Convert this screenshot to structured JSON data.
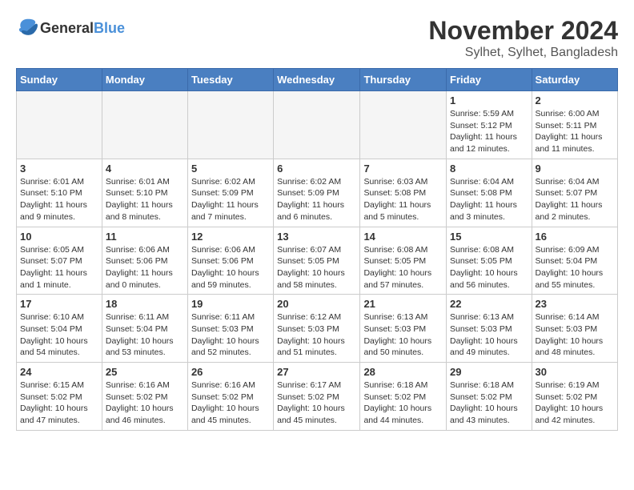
{
  "header": {
    "logo_general": "General",
    "logo_blue": "Blue",
    "month_title": "November 2024",
    "location": "Sylhet, Sylhet, Bangladesh"
  },
  "weekdays": [
    "Sunday",
    "Monday",
    "Tuesday",
    "Wednesday",
    "Thursday",
    "Friday",
    "Saturday"
  ],
  "weeks": [
    [
      {
        "day": "",
        "info": "",
        "empty": true
      },
      {
        "day": "",
        "info": "",
        "empty": true
      },
      {
        "day": "",
        "info": "",
        "empty": true
      },
      {
        "day": "",
        "info": "",
        "empty": true
      },
      {
        "day": "",
        "info": "",
        "empty": true
      },
      {
        "day": "1",
        "info": "Sunrise: 5:59 AM\nSunset: 5:12 PM\nDaylight: 11 hours and 12 minutes."
      },
      {
        "day": "2",
        "info": "Sunrise: 6:00 AM\nSunset: 5:11 PM\nDaylight: 11 hours and 11 minutes."
      }
    ],
    [
      {
        "day": "3",
        "info": "Sunrise: 6:01 AM\nSunset: 5:10 PM\nDaylight: 11 hours and 9 minutes."
      },
      {
        "day": "4",
        "info": "Sunrise: 6:01 AM\nSunset: 5:10 PM\nDaylight: 11 hours and 8 minutes."
      },
      {
        "day": "5",
        "info": "Sunrise: 6:02 AM\nSunset: 5:09 PM\nDaylight: 11 hours and 7 minutes."
      },
      {
        "day": "6",
        "info": "Sunrise: 6:02 AM\nSunset: 5:09 PM\nDaylight: 11 hours and 6 minutes."
      },
      {
        "day": "7",
        "info": "Sunrise: 6:03 AM\nSunset: 5:08 PM\nDaylight: 11 hours and 5 minutes."
      },
      {
        "day": "8",
        "info": "Sunrise: 6:04 AM\nSunset: 5:08 PM\nDaylight: 11 hours and 3 minutes."
      },
      {
        "day": "9",
        "info": "Sunrise: 6:04 AM\nSunset: 5:07 PM\nDaylight: 11 hours and 2 minutes."
      }
    ],
    [
      {
        "day": "10",
        "info": "Sunrise: 6:05 AM\nSunset: 5:07 PM\nDaylight: 11 hours and 1 minute."
      },
      {
        "day": "11",
        "info": "Sunrise: 6:06 AM\nSunset: 5:06 PM\nDaylight: 11 hours and 0 minutes."
      },
      {
        "day": "12",
        "info": "Sunrise: 6:06 AM\nSunset: 5:06 PM\nDaylight: 10 hours and 59 minutes."
      },
      {
        "day": "13",
        "info": "Sunrise: 6:07 AM\nSunset: 5:05 PM\nDaylight: 10 hours and 58 minutes."
      },
      {
        "day": "14",
        "info": "Sunrise: 6:08 AM\nSunset: 5:05 PM\nDaylight: 10 hours and 57 minutes."
      },
      {
        "day": "15",
        "info": "Sunrise: 6:08 AM\nSunset: 5:05 PM\nDaylight: 10 hours and 56 minutes."
      },
      {
        "day": "16",
        "info": "Sunrise: 6:09 AM\nSunset: 5:04 PM\nDaylight: 10 hours and 55 minutes."
      }
    ],
    [
      {
        "day": "17",
        "info": "Sunrise: 6:10 AM\nSunset: 5:04 PM\nDaylight: 10 hours and 54 minutes."
      },
      {
        "day": "18",
        "info": "Sunrise: 6:11 AM\nSunset: 5:04 PM\nDaylight: 10 hours and 53 minutes."
      },
      {
        "day": "19",
        "info": "Sunrise: 6:11 AM\nSunset: 5:03 PM\nDaylight: 10 hours and 52 minutes."
      },
      {
        "day": "20",
        "info": "Sunrise: 6:12 AM\nSunset: 5:03 PM\nDaylight: 10 hours and 51 minutes."
      },
      {
        "day": "21",
        "info": "Sunrise: 6:13 AM\nSunset: 5:03 PM\nDaylight: 10 hours and 50 minutes."
      },
      {
        "day": "22",
        "info": "Sunrise: 6:13 AM\nSunset: 5:03 PM\nDaylight: 10 hours and 49 minutes."
      },
      {
        "day": "23",
        "info": "Sunrise: 6:14 AM\nSunset: 5:03 PM\nDaylight: 10 hours and 48 minutes."
      }
    ],
    [
      {
        "day": "24",
        "info": "Sunrise: 6:15 AM\nSunset: 5:02 PM\nDaylight: 10 hours and 47 minutes."
      },
      {
        "day": "25",
        "info": "Sunrise: 6:16 AM\nSunset: 5:02 PM\nDaylight: 10 hours and 46 minutes."
      },
      {
        "day": "26",
        "info": "Sunrise: 6:16 AM\nSunset: 5:02 PM\nDaylight: 10 hours and 45 minutes."
      },
      {
        "day": "27",
        "info": "Sunrise: 6:17 AM\nSunset: 5:02 PM\nDaylight: 10 hours and 45 minutes."
      },
      {
        "day": "28",
        "info": "Sunrise: 6:18 AM\nSunset: 5:02 PM\nDaylight: 10 hours and 44 minutes."
      },
      {
        "day": "29",
        "info": "Sunrise: 6:18 AM\nSunset: 5:02 PM\nDaylight: 10 hours and 43 minutes."
      },
      {
        "day": "30",
        "info": "Sunrise: 6:19 AM\nSunset: 5:02 PM\nDaylight: 10 hours and 42 minutes."
      }
    ]
  ]
}
